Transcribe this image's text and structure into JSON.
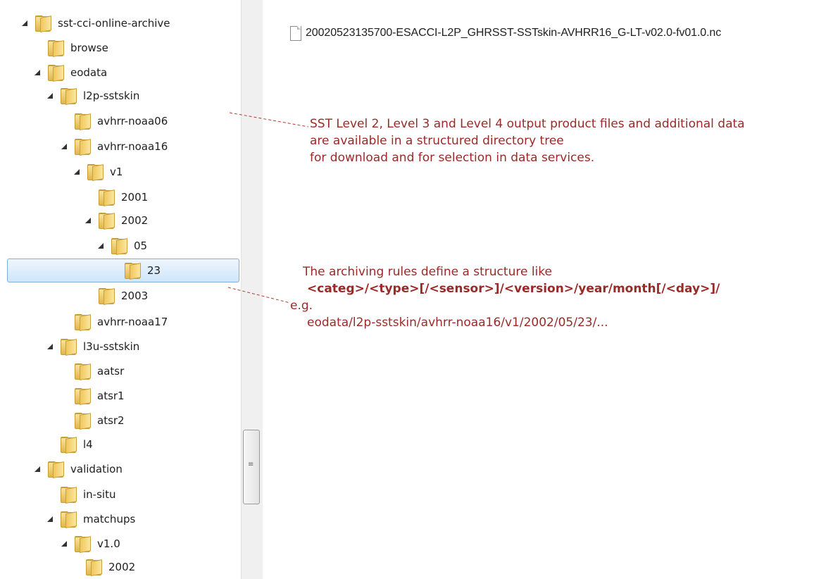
{
  "tree": {
    "items": [
      {
        "label": "sst-cci-online-archive",
        "expanded": true
      },
      {
        "label": "browse",
        "expanded": false
      },
      {
        "label": "eodata",
        "expanded": true
      },
      {
        "label": "l2p-sstskin",
        "expanded": true
      },
      {
        "label": "avhrr-noaa06",
        "expanded": false
      },
      {
        "label": "avhrr-noaa16",
        "expanded": true
      },
      {
        "label": "v1",
        "expanded": true
      },
      {
        "label": "2001",
        "expanded": false
      },
      {
        "label": "2002",
        "expanded": true
      },
      {
        "label": "05",
        "expanded": true
      },
      {
        "label": "23",
        "expanded": false,
        "selected": true
      },
      {
        "label": "2003",
        "expanded": false
      },
      {
        "label": "avhrr-noaa17",
        "expanded": false
      },
      {
        "label": "l3u-sstskin",
        "expanded": true
      },
      {
        "label": "aatsr",
        "expanded": false
      },
      {
        "label": "atsr1",
        "expanded": false
      },
      {
        "label": "atsr2",
        "expanded": false
      },
      {
        "label": "l4",
        "expanded": false
      },
      {
        "label": "validation",
        "expanded": true
      },
      {
        "label": "in-situ",
        "expanded": false
      },
      {
        "label": "matchups",
        "expanded": true
      },
      {
        "label": "v1.0",
        "expanded": true
      },
      {
        "label": "2002",
        "expanded": false
      }
    ]
  },
  "content": {
    "file_name": "20020523135700-ESACCI-L2P_GHRSST-SSTskin-AVHRR16_G-LT-v02.0-fv01.0.nc"
  },
  "notes": {
    "structure": {
      "line1": "SST Level 2, Level 3 and Level 4 output product files and additional data",
      "line2": "are available in a structured directory tree",
      "line3": "for download and for selection in data services."
    },
    "archiving": {
      "line1": "The archiving rules define a structure like",
      "pattern": "<categ>/<type>[/<sensor>]/<version>/year/month[/<day>]/",
      "eg_label": "e.g.",
      "example": "eodata/l2p-sstskin/avhrr-noaa16/v1/2002/05/23/..."
    }
  },
  "colors": {
    "note_text": "#9b2a27",
    "selection_border": "#84acdd",
    "folder": "#e1b64b"
  }
}
